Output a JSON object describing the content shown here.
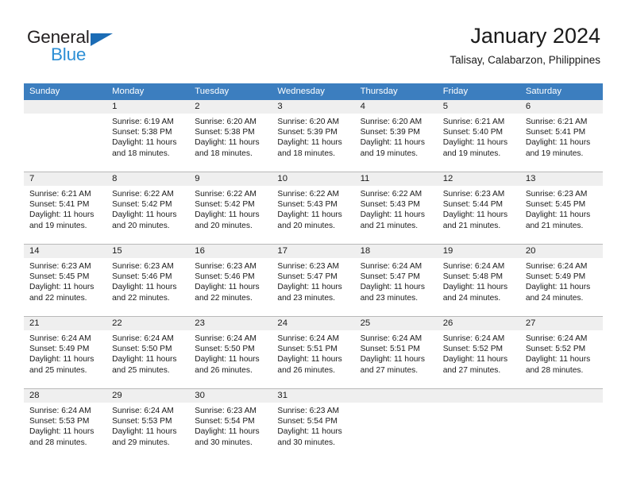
{
  "brand": {
    "name_part1": "General",
    "name_part2": "Blue",
    "triangle_icon": "triangle-icon"
  },
  "header": {
    "title": "January 2024",
    "location": "Talisay, Calabarzon, Philippines"
  },
  "colors": {
    "header_blue": "#3c7ebf",
    "logo_blue": "#2d8fd5",
    "logo_dark": "#231f20",
    "day_band": "#efefef",
    "row_divider": "#b9b9b9"
  },
  "weekdays": [
    "Sunday",
    "Monday",
    "Tuesday",
    "Wednesday",
    "Thursday",
    "Friday",
    "Saturday"
  ],
  "labels": {
    "sunrise_prefix": "Sunrise:",
    "sunset_prefix": "Sunset:",
    "daylight_prefix": "Daylight:"
  },
  "weeks": [
    {
      "days": [
        {
          "num": "",
          "sunrise": "",
          "sunset": "",
          "daylight_line1": "",
          "daylight_line2": ""
        },
        {
          "num": "1",
          "sunrise": "Sunrise: 6:19 AM",
          "sunset": "Sunset: 5:38 PM",
          "daylight_line1": "Daylight: 11 hours",
          "daylight_line2": "and 18 minutes."
        },
        {
          "num": "2",
          "sunrise": "Sunrise: 6:20 AM",
          "sunset": "Sunset: 5:38 PM",
          "daylight_line1": "Daylight: 11 hours",
          "daylight_line2": "and 18 minutes."
        },
        {
          "num": "3",
          "sunrise": "Sunrise: 6:20 AM",
          "sunset": "Sunset: 5:39 PM",
          "daylight_line1": "Daylight: 11 hours",
          "daylight_line2": "and 18 minutes."
        },
        {
          "num": "4",
          "sunrise": "Sunrise: 6:20 AM",
          "sunset": "Sunset: 5:39 PM",
          "daylight_line1": "Daylight: 11 hours",
          "daylight_line2": "and 19 minutes."
        },
        {
          "num": "5",
          "sunrise": "Sunrise: 6:21 AM",
          "sunset": "Sunset: 5:40 PM",
          "daylight_line1": "Daylight: 11 hours",
          "daylight_line2": "and 19 minutes."
        },
        {
          "num": "6",
          "sunrise": "Sunrise: 6:21 AM",
          "sunset": "Sunset: 5:41 PM",
          "daylight_line1": "Daylight: 11 hours",
          "daylight_line2": "and 19 minutes."
        }
      ]
    },
    {
      "days": [
        {
          "num": "7",
          "sunrise": "Sunrise: 6:21 AM",
          "sunset": "Sunset: 5:41 PM",
          "daylight_line1": "Daylight: 11 hours",
          "daylight_line2": "and 19 minutes."
        },
        {
          "num": "8",
          "sunrise": "Sunrise: 6:22 AM",
          "sunset": "Sunset: 5:42 PM",
          "daylight_line1": "Daylight: 11 hours",
          "daylight_line2": "and 20 minutes."
        },
        {
          "num": "9",
          "sunrise": "Sunrise: 6:22 AM",
          "sunset": "Sunset: 5:42 PM",
          "daylight_line1": "Daylight: 11 hours",
          "daylight_line2": "and 20 minutes."
        },
        {
          "num": "10",
          "sunrise": "Sunrise: 6:22 AM",
          "sunset": "Sunset: 5:43 PM",
          "daylight_line1": "Daylight: 11 hours",
          "daylight_line2": "and 20 minutes."
        },
        {
          "num": "11",
          "sunrise": "Sunrise: 6:22 AM",
          "sunset": "Sunset: 5:43 PM",
          "daylight_line1": "Daylight: 11 hours",
          "daylight_line2": "and 21 minutes."
        },
        {
          "num": "12",
          "sunrise": "Sunrise: 6:23 AM",
          "sunset": "Sunset: 5:44 PM",
          "daylight_line1": "Daylight: 11 hours",
          "daylight_line2": "and 21 minutes."
        },
        {
          "num": "13",
          "sunrise": "Sunrise: 6:23 AM",
          "sunset": "Sunset: 5:45 PM",
          "daylight_line1": "Daylight: 11 hours",
          "daylight_line2": "and 21 minutes."
        }
      ]
    },
    {
      "days": [
        {
          "num": "14",
          "sunrise": "Sunrise: 6:23 AM",
          "sunset": "Sunset: 5:45 PM",
          "daylight_line1": "Daylight: 11 hours",
          "daylight_line2": "and 22 minutes."
        },
        {
          "num": "15",
          "sunrise": "Sunrise: 6:23 AM",
          "sunset": "Sunset: 5:46 PM",
          "daylight_line1": "Daylight: 11 hours",
          "daylight_line2": "and 22 minutes."
        },
        {
          "num": "16",
          "sunrise": "Sunrise: 6:23 AM",
          "sunset": "Sunset: 5:46 PM",
          "daylight_line1": "Daylight: 11 hours",
          "daylight_line2": "and 22 minutes."
        },
        {
          "num": "17",
          "sunrise": "Sunrise: 6:23 AM",
          "sunset": "Sunset: 5:47 PM",
          "daylight_line1": "Daylight: 11 hours",
          "daylight_line2": "and 23 minutes."
        },
        {
          "num": "18",
          "sunrise": "Sunrise: 6:24 AM",
          "sunset": "Sunset: 5:47 PM",
          "daylight_line1": "Daylight: 11 hours",
          "daylight_line2": "and 23 minutes."
        },
        {
          "num": "19",
          "sunrise": "Sunrise: 6:24 AM",
          "sunset": "Sunset: 5:48 PM",
          "daylight_line1": "Daylight: 11 hours",
          "daylight_line2": "and 24 minutes."
        },
        {
          "num": "20",
          "sunrise": "Sunrise: 6:24 AM",
          "sunset": "Sunset: 5:49 PM",
          "daylight_line1": "Daylight: 11 hours",
          "daylight_line2": "and 24 minutes."
        }
      ]
    },
    {
      "days": [
        {
          "num": "21",
          "sunrise": "Sunrise: 6:24 AM",
          "sunset": "Sunset: 5:49 PM",
          "daylight_line1": "Daylight: 11 hours",
          "daylight_line2": "and 25 minutes."
        },
        {
          "num": "22",
          "sunrise": "Sunrise: 6:24 AM",
          "sunset": "Sunset: 5:50 PM",
          "daylight_line1": "Daylight: 11 hours",
          "daylight_line2": "and 25 minutes."
        },
        {
          "num": "23",
          "sunrise": "Sunrise: 6:24 AM",
          "sunset": "Sunset: 5:50 PM",
          "daylight_line1": "Daylight: 11 hours",
          "daylight_line2": "and 26 minutes."
        },
        {
          "num": "24",
          "sunrise": "Sunrise: 6:24 AM",
          "sunset": "Sunset: 5:51 PM",
          "daylight_line1": "Daylight: 11 hours",
          "daylight_line2": "and 26 minutes."
        },
        {
          "num": "25",
          "sunrise": "Sunrise: 6:24 AM",
          "sunset": "Sunset: 5:51 PM",
          "daylight_line1": "Daylight: 11 hours",
          "daylight_line2": "and 27 minutes."
        },
        {
          "num": "26",
          "sunrise": "Sunrise: 6:24 AM",
          "sunset": "Sunset: 5:52 PM",
          "daylight_line1": "Daylight: 11 hours",
          "daylight_line2": "and 27 minutes."
        },
        {
          "num": "27",
          "sunrise": "Sunrise: 6:24 AM",
          "sunset": "Sunset: 5:52 PM",
          "daylight_line1": "Daylight: 11 hours",
          "daylight_line2": "and 28 minutes."
        }
      ]
    },
    {
      "days": [
        {
          "num": "28",
          "sunrise": "Sunrise: 6:24 AM",
          "sunset": "Sunset: 5:53 PM",
          "daylight_line1": "Daylight: 11 hours",
          "daylight_line2": "and 28 minutes."
        },
        {
          "num": "29",
          "sunrise": "Sunrise: 6:24 AM",
          "sunset": "Sunset: 5:53 PM",
          "daylight_line1": "Daylight: 11 hours",
          "daylight_line2": "and 29 minutes."
        },
        {
          "num": "30",
          "sunrise": "Sunrise: 6:23 AM",
          "sunset": "Sunset: 5:54 PM",
          "daylight_line1": "Daylight: 11 hours",
          "daylight_line2": "and 30 minutes."
        },
        {
          "num": "31",
          "sunrise": "Sunrise: 6:23 AM",
          "sunset": "Sunset: 5:54 PM",
          "daylight_line1": "Daylight: 11 hours",
          "daylight_line2": "and 30 minutes."
        },
        {
          "num": "",
          "sunrise": "",
          "sunset": "",
          "daylight_line1": "",
          "daylight_line2": ""
        },
        {
          "num": "",
          "sunrise": "",
          "sunset": "",
          "daylight_line1": "",
          "daylight_line2": ""
        },
        {
          "num": "",
          "sunrise": "",
          "sunset": "",
          "daylight_line1": "",
          "daylight_line2": ""
        }
      ]
    }
  ]
}
